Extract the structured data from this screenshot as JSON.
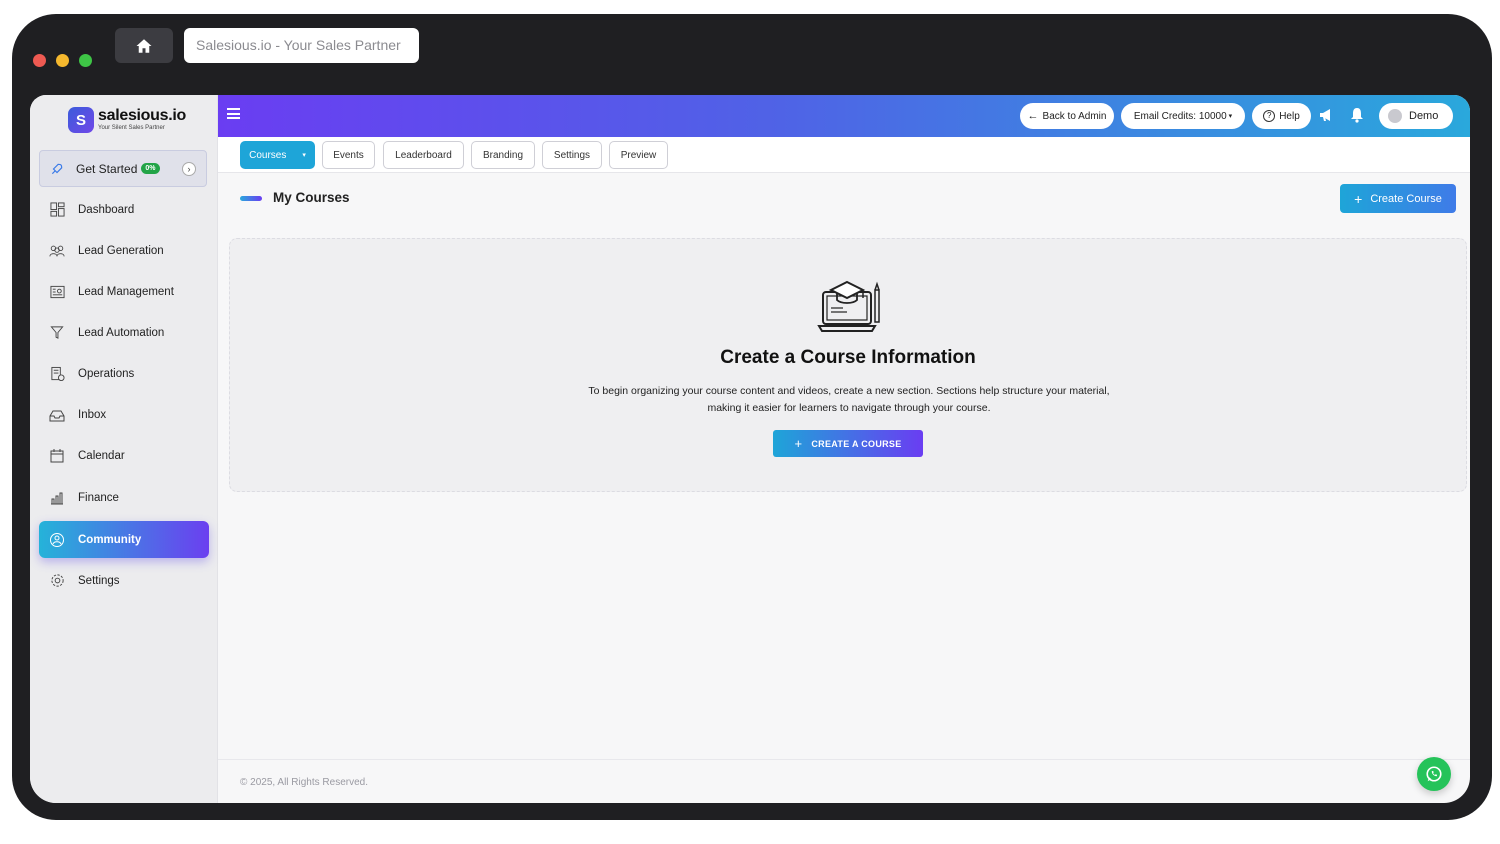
{
  "browser": {
    "url_title": "Salesious.io - Your Sales Partner",
    "home_icon": "home-icon"
  },
  "logo": {
    "name": "salesious.io",
    "tagline": "Your Silent Sales Partner",
    "mark": "S"
  },
  "sidebar": {
    "get_started": {
      "label": "Get Started",
      "badge": "0%"
    },
    "items": [
      {
        "label": "Dashboard",
        "icon": "dashboard-icon"
      },
      {
        "label": "Lead Generation",
        "icon": "users-icon"
      },
      {
        "label": "Lead Management",
        "icon": "contact-card-icon"
      },
      {
        "label": "Lead Automation",
        "icon": "funnel-icon"
      },
      {
        "label": "Operations",
        "icon": "operations-icon"
      },
      {
        "label": "Inbox",
        "icon": "inbox-icon"
      },
      {
        "label": "Calendar",
        "icon": "calendar-icon"
      },
      {
        "label": "Finance",
        "icon": "finance-chart-icon"
      },
      {
        "label": "Community",
        "icon": "community-icon",
        "active": true
      },
      {
        "label": "Settings",
        "icon": "gear-icon"
      }
    ]
  },
  "topbar": {
    "back_to_admin": "Back to Admin",
    "email_credits": "Email Credits: 10000",
    "help": "Help",
    "user": "Demo"
  },
  "tabs": [
    {
      "label": "Courses",
      "active": true
    },
    {
      "label": "Events"
    },
    {
      "label": "Leaderboard"
    },
    {
      "label": "Branding"
    },
    {
      "label": "Settings"
    },
    {
      "label": "Preview"
    }
  ],
  "main": {
    "title": "My Courses",
    "create_button": "Create Course",
    "empty_state": {
      "title": "Create a Course Information",
      "description": "To begin organizing your course content and videos, create a new section. Sections help structure your material, making it easier for learners to navigate through your course.",
      "button": "CREATE A COURSE"
    }
  },
  "footer": {
    "copyright": "© 2025, All Rights Reserved."
  },
  "colors": {
    "accent_blue": "#1ea5d8",
    "accent_purple": "#6a3df2",
    "whatsapp_green": "#25c35a"
  }
}
